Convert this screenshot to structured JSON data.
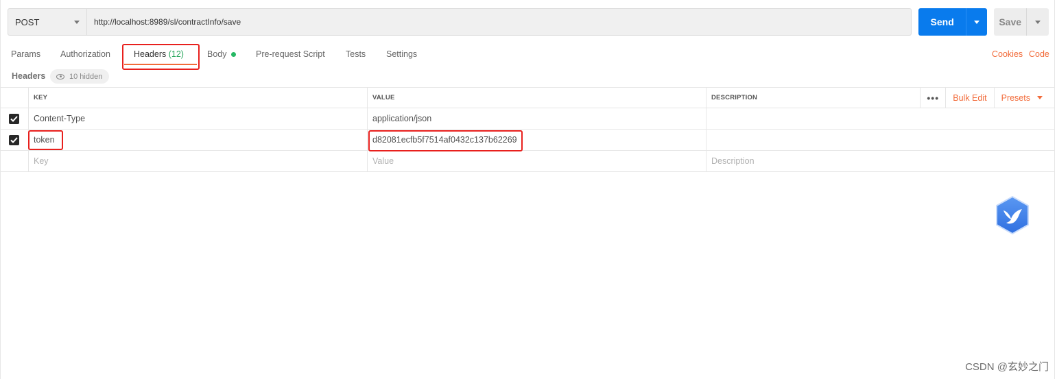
{
  "request": {
    "method": "POST",
    "url": "http://localhost:8989/sl/contractInfo/save",
    "send_label": "Send",
    "save_label": "Save"
  },
  "tabs": [
    {
      "label": "Params"
    },
    {
      "label": "Authorization"
    },
    {
      "label": "Headers",
      "count": "(12)",
      "active": true
    },
    {
      "label": "Body",
      "has_content_dot": true
    },
    {
      "label": "Pre-request Script"
    },
    {
      "label": "Tests"
    },
    {
      "label": "Settings"
    }
  ],
  "right_links": {
    "cookies": "Cookies",
    "code": "Code"
  },
  "headers_section": {
    "title": "Headers",
    "hidden_label": "10 hidden"
  },
  "table": {
    "columns": {
      "key": "KEY",
      "value": "VALUE",
      "description": "DESCRIPTION"
    },
    "more_label": "•••",
    "bulk_edit": "Bulk Edit",
    "presets": "Presets",
    "rows": [
      {
        "checked": true,
        "key": "Content-Type",
        "value": "application/json",
        "description": ""
      },
      {
        "checked": true,
        "key": "token",
        "value": "d82081ecfb5f7514af0432c137b62269",
        "description": ""
      }
    ],
    "placeholders": {
      "key": "Key",
      "value": "Value",
      "description": "Description"
    }
  },
  "watermark": "CSDN @玄妙之门",
  "colors": {
    "accent": "#f26b3a",
    "send": "#097bed",
    "highlight": "#e8201d",
    "count_green": "#26a65b",
    "widget_blue": "#3d7ee6"
  },
  "icons": {
    "method_caret": "chevron-down-icon",
    "eye": "eye-icon",
    "check": "checkmark-icon",
    "widget": "bird-logo-icon"
  }
}
